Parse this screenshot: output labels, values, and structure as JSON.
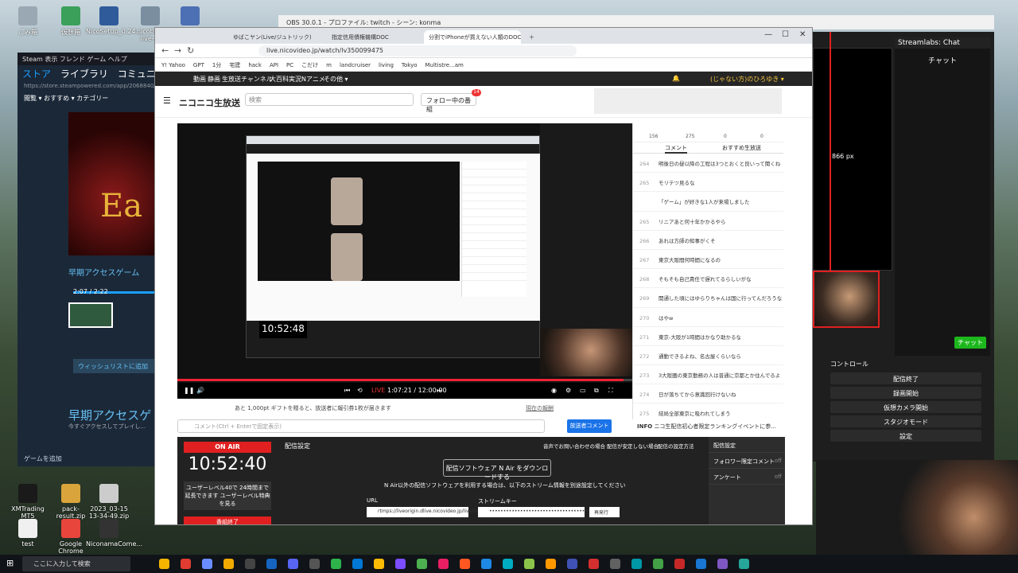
{
  "desktop": {
    "icons": [
      {
        "label": "ごみ箱",
        "color": "#9aa8b3"
      },
      {
        "label": "仮想箱",
        "color": "#3aa05a"
      },
      {
        "label": "NicoSetup_0.24...",
        "color": "#2f5b9a"
      },
      {
        "label": "nicobox-live-...",
        "color": "#7a8ea0"
      },
      {
        "label": "Cardan(Rec) ...",
        "color": "#4d6fb3"
      },
      {
        "label": "XMTrading MT5",
        "color": "#1a1a1a"
      },
      {
        "label": "pack-result.zip",
        "color": "#d9a43b"
      },
      {
        "label": "2023_03-15 13-34-49.zip",
        "color": "#ccc"
      },
      {
        "label": "test",
        "color": "#f0f0f0"
      },
      {
        "label": "Google Chrome",
        "color": "#e8453c"
      },
      {
        "label": "NiconamaCome...",
        "color": "#333"
      }
    ]
  },
  "steam": {
    "menu": "Steam  表示  フレンド  ゲーム  ヘルプ",
    "tabs": [
      "ストア",
      "ライブラリ",
      "コミュニティ"
    ],
    "url": "https://store.steampowered.com/app/2068840/Eta...",
    "sub": "閲覧 ▾   おすすめ ▾   カテゴリー",
    "hero_text": "Ea",
    "time": "2:07 / 2:22",
    "early_small": "早期アクセスゲーム",
    "wishlist": "ウィッシュリストに追加",
    "early_title": "早期アクセスゲ",
    "early_desc": "今すぐアクセスしてプレイし...",
    "add_game": "ゲームを追加"
  },
  "obs": {
    "title": "OBS 30.0.1 - プロファイル: twitch - シーン: konma",
    "chat_header": "Streamlabs: Chat",
    "chat_label": "チャット",
    "px_label": "866 px",
    "chat_button": "チャット",
    "controls_header": "コントロール",
    "controls": [
      "配信終了",
      "録画開始",
      "仮想カメラ開始",
      "スタジオモード",
      "設定"
    ]
  },
  "browser": {
    "tabs": [
      {
        "label": "ゆばこヤン(Live/ジュトリック)"
      },
      {
        "label": "指定信用債権機構DOC"
      },
      {
        "label": "分割でiPhoneが買えない人類のDOC",
        "active": true
      }
    ],
    "url": "live.nicovideo.jp/watch/lv350099475",
    "bookmarks": [
      "Y! Yahoo",
      "GPT",
      "1分",
      "宅建",
      "hack",
      "API",
      "PC",
      "こだけ",
      "m",
      "landcruiser",
      "living",
      "Tokyo",
      "Multistre...am"
    ]
  },
  "nico": {
    "nav": [
      "動画",
      "静画",
      "生放送",
      "チャンネル",
      "大百科",
      "実況",
      "Nアニメ",
      "その他 ▾"
    ],
    "user": "(じゃない方)のひろゆき ▾",
    "logo": "ニコニコ生放送",
    "search_placeholder": "検索",
    "follow_label": "フォロー中の番組",
    "follow_count": "14",
    "stats": [
      "156",
      "275",
      "0",
      "0"
    ],
    "comment_tabs": [
      "コメント",
      "おすすめ生放送"
    ],
    "comments": [
      {
        "n": "264",
        "text": "明後日の昼以降の工程は3つとおくと良いって聞くね"
      },
      {
        "n": "265",
        "text": "モリテツ見るな"
      },
      {
        "n": "",
        "text": "「ゲーム」が好きな1人が来場しました"
      },
      {
        "n": "265",
        "text": "リニアあと何十年かかるやら"
      },
      {
        "n": "266",
        "text": "あれは方師の知事がくそ"
      },
      {
        "n": "267",
        "text": "東京大阪間何時間になるの"
      },
      {
        "n": "268",
        "text": "そもそも自己責任で遅れてるらしいがな"
      },
      {
        "n": "269",
        "text": "開通した頃にはゆらりちゃんは国に行ってんだろうな"
      },
      {
        "n": "270",
        "text": "はやw"
      },
      {
        "n": "271",
        "text": "東京-大阪が1時間はかなり助かるな"
      },
      {
        "n": "272",
        "text": "通勤できるよね、名古屋くらいなら"
      },
      {
        "n": "273",
        "text": "3大阪圏の東京勤務の人は普通に京都とか住んでるよ"
      },
      {
        "n": "274",
        "text": "日が落ちてから意識回行けないね"
      },
      {
        "n": "275",
        "text": "結局全部東京に吸われてしまう"
      }
    ],
    "player_time": "1:07:21 / 12:00:00",
    "live_label": "LIVE",
    "inner_clock": "10:52:48",
    "gift_text": "あと 1,000pt ギフトを贈ると、放送者に報引券1枚が届きます",
    "gift_link": "現在の報酬",
    "comment_placeholder": "コメント(Ctrl + Enterで固定表示)",
    "broadcaster_comment": "放送者コメント",
    "info_label": "INFO",
    "info_text": "ニコ生配信初心者限定ランキングイベントに参...",
    "onair": "ON AIR",
    "clock": "10:52:40",
    "user_level": "ユーザーレベル40で 24時間まで延長できます ユーザーレベル特典を見る",
    "end_button": "番組終了",
    "settings_title": "配信設定",
    "help": [
      "音声でお問い合わせの場合",
      "配信が安定しない場合",
      "配信の設定方法"
    ],
    "download_button": "配信ソフトウェア N Air をダウンロードする",
    "download_note": "N Air以外の配信ソフトウェアを利用する場合は、以下のストリーム情報を別途設定してください",
    "url_label": "URL",
    "url_value": "rtmps://liveorigin.dlive.nicovideo.jp/live/input",
    "key_label": "ストリームキー",
    "key_value": "•••••••••••••••••••••••••••••••••••••",
    "reissue": "再発行",
    "side": [
      {
        "label": "配信設定",
        "status": ""
      },
      {
        "label": "フォロワー限定コメント",
        "status": "off"
      },
      {
        "label": "アンケート",
        "status": "off"
      }
    ]
  },
  "taskbar": {
    "search": "ここに入力して検索",
    "apps": [
      "#f4b400",
      "#e03c31",
      "#6a8dff",
      "#f2a900",
      "#444",
      "#1565c0",
      "#5865f2",
      "#555",
      "#2db34a",
      "#0078d4",
      "#fbbc05",
      "#7c4dff",
      "#4caf50",
      "#e91e63",
      "#ff5722",
      "#1e88e5",
      "#00acc1",
      "#8bc34a",
      "#ff9800",
      "#3f51b5",
      "#d32f2f",
      "#616161",
      "#0097a7",
      "#43a047",
      "#c62828",
      "#1976d2",
      "#7e57c2",
      "#26a69a"
    ]
  }
}
